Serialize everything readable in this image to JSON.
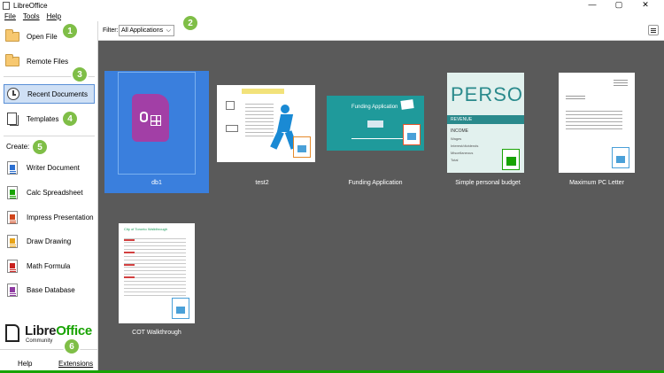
{
  "window": {
    "title": "LibreOffice",
    "controls": [
      "—",
      "▢",
      "✕"
    ]
  },
  "menubar": {
    "file": "File",
    "tools": "Tools",
    "help": "Help"
  },
  "sidebar": {
    "open_file": "Open File",
    "remote_files": "Remote Files",
    "recent_documents": "Recent Documents",
    "templates": "Templates",
    "create_label": "Create:",
    "create_items": [
      {
        "label": "Writer Document",
        "color": "#2b6fd1"
      },
      {
        "label": "Calc Spreadsheet",
        "color": "#18a303"
      },
      {
        "label": "Impress Presentation",
        "color": "#d0451b"
      },
      {
        "label": "Draw Drawing",
        "color": "#e8a317"
      },
      {
        "label": "Math Formula",
        "color": "#c9211e"
      },
      {
        "label": "Base Database",
        "color": "#8e3aa1"
      }
    ],
    "logo_libre": "Libre",
    "logo_office": "Office",
    "logo_community": "Community",
    "help": "Help",
    "extensions": "Extensions"
  },
  "filter": {
    "label": "Filter:",
    "value": "All Applications"
  },
  "documents": [
    {
      "name": "db1",
      "selected": true
    },
    {
      "name": "test2"
    },
    {
      "name": "Funding Application"
    },
    {
      "name": "Simple personal budget"
    },
    {
      "name": "Maximum PC Letter"
    },
    {
      "name": "COT Walkthrough"
    }
  ],
  "thumbs": {
    "funding_title": "Funding Application",
    "budget_title": "PERSO",
    "budget_rows": [
      "REVENUE",
      "INCOME",
      "Wages",
      "Interest/dividends",
      "Miscellaneous",
      "Total"
    ],
    "cot_title": "City of Toronto Walkthrough"
  },
  "callouts": [
    "1",
    "2",
    "3",
    "4",
    "5",
    "6"
  ],
  "colors": {
    "accent": "#18a303",
    "selection": "#3a7fdd",
    "callout": "#7fbe47",
    "base_purple": "#a23fa6"
  }
}
